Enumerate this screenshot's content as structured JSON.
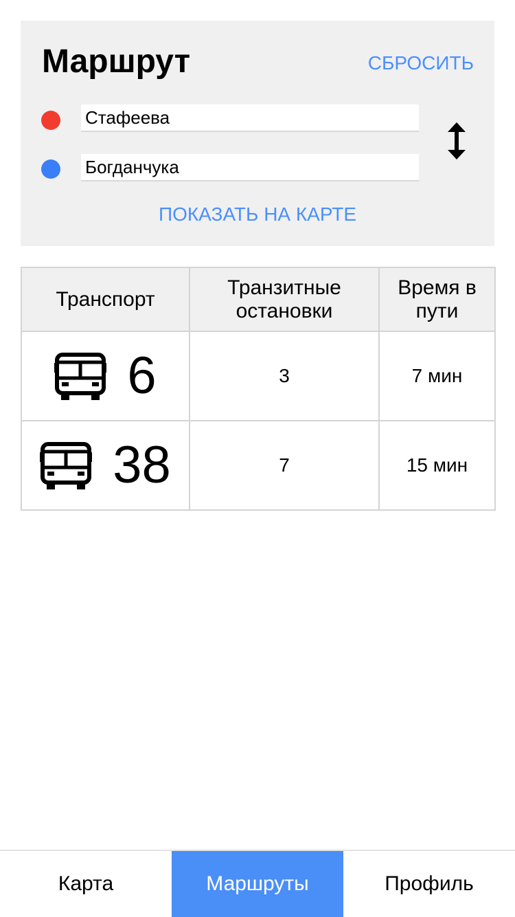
{
  "route": {
    "title": "Маршрут",
    "reset_label": "СБРОСИТЬ",
    "from_value": "Стафеева",
    "to_value": "Богданчука",
    "show_on_map_label": "ПОКАЗАТЬ НА КАРТЕ",
    "from_dot_color": "#f23c30",
    "to_dot_color": "#3a7ff7",
    "swap_icon": "vertical-double-arrow-icon"
  },
  "table": {
    "headers": {
      "transport": "Транспорт",
      "transit_stops": "Транзитные остановки",
      "travel_time": "Время в пути"
    },
    "rows": [
      {
        "icon": "bus-icon",
        "number": "6",
        "stops": "3",
        "time": "7 мин"
      },
      {
        "icon": "bus-icon",
        "number": "38",
        "stops": "7",
        "time": "15 мин"
      }
    ]
  },
  "nav": {
    "items": [
      {
        "label": "Карта",
        "active": false
      },
      {
        "label": "Маршруты",
        "active": true
      },
      {
        "label": "Профиль",
        "active": false
      }
    ],
    "accent_color": "#4a8ef8"
  }
}
